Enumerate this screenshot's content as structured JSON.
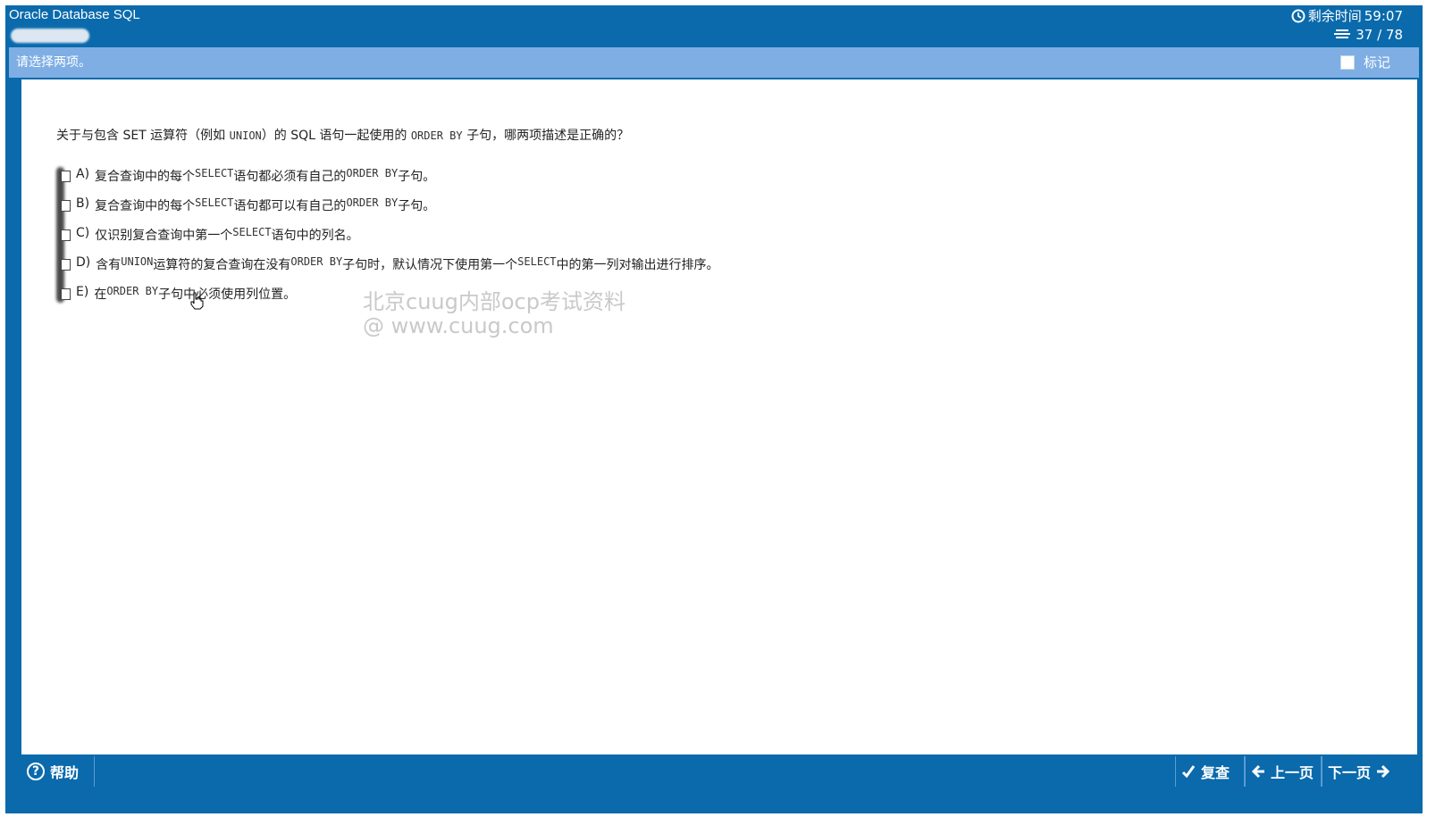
{
  "window": {
    "title": "Oracle Database SQL",
    "timer_label": "剩余时间",
    "timer_value": "59:07",
    "counter": "37 / 78"
  },
  "instruction": {
    "text": "请选择两项。",
    "mark_label": "标记"
  },
  "question": {
    "parts": [
      "关于与包含 SET 运算符（例如 ",
      "UNION",
      "）的 SQL 语句一起使用的 ",
      "ORDER BY",
      " 子句，哪两项描述是正确的？"
    ]
  },
  "options": [
    {
      "letter": "A)",
      "parts": [
        "复合查询中的每个 ",
        "SELECT",
        " 语句都必须有自己的 ",
        "ORDER BY",
        " 子句。"
      ]
    },
    {
      "letter": "B)",
      "parts": [
        "复合查询中的每个 ",
        "SELECT",
        " 语句都可以有自己的 ",
        "ORDER BY",
        " 子句。"
      ]
    },
    {
      "letter": "C)",
      "parts": [
        "仅识别复合查询中第一个 ",
        "SELECT",
        " 语句中的列名。"
      ]
    },
    {
      "letter": "D)",
      "parts": [
        "含有 ",
        "UNION",
        " 运算符的复合查询在没有 ",
        "ORDER BY",
        " 子句时，默认情况下使用第一个 ",
        "SELECT",
        " 中的第一列对输出进行排序。"
      ]
    },
    {
      "letter": "E)",
      "parts": [
        "在 ",
        "ORDER BY",
        " 子句中必须使用列位置。"
      ]
    }
  ],
  "watermark": {
    "line1": "北京cuug内部ocp考试资料",
    "line2": "@ www.cuug.com"
  },
  "footer": {
    "help_label": "帮助",
    "review_label": "复查",
    "prev_label": "上一页",
    "next_label": "下一页"
  },
  "icons": {
    "timer": "clock-icon",
    "counter": "list-icon",
    "help": "help-circle-icon",
    "review": "checkmark-icon",
    "prev": "arrow-left-icon",
    "next": "arrow-right-icon"
  },
  "colors": {
    "primary": "#0a6aac",
    "instruction_bar": "#7eaee4",
    "watermark": "#c9c9c9"
  }
}
